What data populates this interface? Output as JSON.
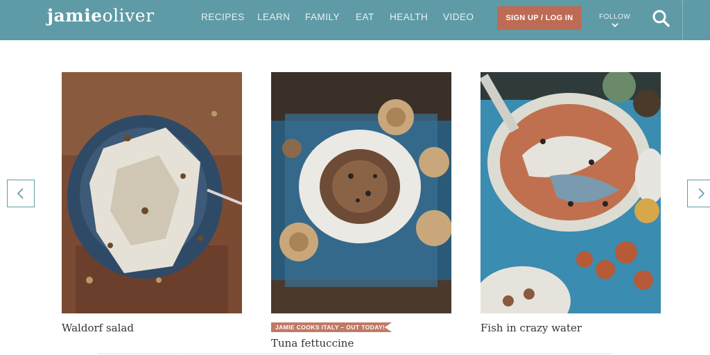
{
  "header": {
    "logo_bold": "jamie",
    "logo_regular": "oliver",
    "nav": [
      "RECIPES",
      "LEARN",
      "FAMILY",
      "EAT",
      "HEALTH",
      "VIDEO"
    ],
    "cta": "SIGN UP / LOG IN",
    "follow": "FOLLOW",
    "colors": {
      "bar": "#5e9ba6",
      "cta": "#bd6b55"
    }
  },
  "carousel": {
    "cards": [
      {
        "title": "Waldorf salad"
      },
      {
        "badge": "JAMIE COOKS ITALY – OUT TODAY!",
        "title": "Tuna fettuccine"
      },
      {
        "title": "Fish in crazy water"
      }
    ],
    "prev_icon": "chevron-left-icon",
    "next_icon": "chevron-right-icon"
  }
}
